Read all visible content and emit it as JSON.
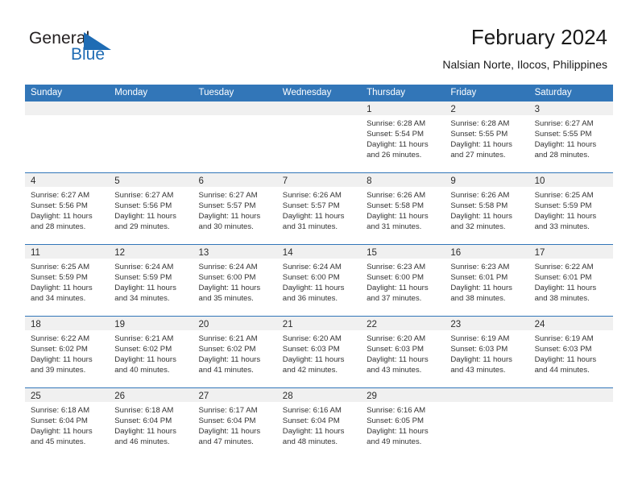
{
  "brand": {
    "word_one": "General",
    "word_two": "Blue",
    "triangle_icon": "triangle-icon",
    "colors": {
      "general": "#231f20",
      "blue": "#1f6cb4"
    }
  },
  "header": {
    "title": "February 2024",
    "subtitle": "Nalsian Norte, Ilocos, Philippines"
  },
  "colors": {
    "header_blue": "#3276b8",
    "day_band_gray": "#f0f0f0",
    "text": "#333333"
  },
  "calendar": {
    "weekday_headers": [
      "Sunday",
      "Monday",
      "Tuesday",
      "Wednesday",
      "Thursday",
      "Friday",
      "Saturday"
    ],
    "weeks": [
      [
        {
          "day": "",
          "lines": []
        },
        {
          "day": "",
          "lines": []
        },
        {
          "day": "",
          "lines": []
        },
        {
          "day": "",
          "lines": []
        },
        {
          "day": "1",
          "lines": [
            "Sunrise: 6:28 AM",
            "Sunset: 5:54 PM",
            "Daylight: 11 hours",
            "and 26 minutes."
          ]
        },
        {
          "day": "2",
          "lines": [
            "Sunrise: 6:28 AM",
            "Sunset: 5:55 PM",
            "Daylight: 11 hours",
            "and 27 minutes."
          ]
        },
        {
          "day": "3",
          "lines": [
            "Sunrise: 6:27 AM",
            "Sunset: 5:55 PM",
            "Daylight: 11 hours",
            "and 28 minutes."
          ]
        }
      ],
      [
        {
          "day": "4",
          "lines": [
            "Sunrise: 6:27 AM",
            "Sunset: 5:56 PM",
            "Daylight: 11 hours",
            "and 28 minutes."
          ]
        },
        {
          "day": "5",
          "lines": [
            "Sunrise: 6:27 AM",
            "Sunset: 5:56 PM",
            "Daylight: 11 hours",
            "and 29 minutes."
          ]
        },
        {
          "day": "6",
          "lines": [
            "Sunrise: 6:27 AM",
            "Sunset: 5:57 PM",
            "Daylight: 11 hours",
            "and 30 minutes."
          ]
        },
        {
          "day": "7",
          "lines": [
            "Sunrise: 6:26 AM",
            "Sunset: 5:57 PM",
            "Daylight: 11 hours",
            "and 31 minutes."
          ]
        },
        {
          "day": "8",
          "lines": [
            "Sunrise: 6:26 AM",
            "Sunset: 5:58 PM",
            "Daylight: 11 hours",
            "and 31 minutes."
          ]
        },
        {
          "day": "9",
          "lines": [
            "Sunrise: 6:26 AM",
            "Sunset: 5:58 PM",
            "Daylight: 11 hours",
            "and 32 minutes."
          ]
        },
        {
          "day": "10",
          "lines": [
            "Sunrise: 6:25 AM",
            "Sunset: 5:59 PM",
            "Daylight: 11 hours",
            "and 33 minutes."
          ]
        }
      ],
      [
        {
          "day": "11",
          "lines": [
            "Sunrise: 6:25 AM",
            "Sunset: 5:59 PM",
            "Daylight: 11 hours",
            "and 34 minutes."
          ]
        },
        {
          "day": "12",
          "lines": [
            "Sunrise: 6:24 AM",
            "Sunset: 5:59 PM",
            "Daylight: 11 hours",
            "and 34 minutes."
          ]
        },
        {
          "day": "13",
          "lines": [
            "Sunrise: 6:24 AM",
            "Sunset: 6:00 PM",
            "Daylight: 11 hours",
            "and 35 minutes."
          ]
        },
        {
          "day": "14",
          "lines": [
            "Sunrise: 6:24 AM",
            "Sunset: 6:00 PM",
            "Daylight: 11 hours",
            "and 36 minutes."
          ]
        },
        {
          "day": "15",
          "lines": [
            "Sunrise: 6:23 AM",
            "Sunset: 6:00 PM",
            "Daylight: 11 hours",
            "and 37 minutes."
          ]
        },
        {
          "day": "16",
          "lines": [
            "Sunrise: 6:23 AM",
            "Sunset: 6:01 PM",
            "Daylight: 11 hours",
            "and 38 minutes."
          ]
        },
        {
          "day": "17",
          "lines": [
            "Sunrise: 6:22 AM",
            "Sunset: 6:01 PM",
            "Daylight: 11 hours",
            "and 38 minutes."
          ]
        }
      ],
      [
        {
          "day": "18",
          "lines": [
            "Sunrise: 6:22 AM",
            "Sunset: 6:02 PM",
            "Daylight: 11 hours",
            "and 39 minutes."
          ]
        },
        {
          "day": "19",
          "lines": [
            "Sunrise: 6:21 AM",
            "Sunset: 6:02 PM",
            "Daylight: 11 hours",
            "and 40 minutes."
          ]
        },
        {
          "day": "20",
          "lines": [
            "Sunrise: 6:21 AM",
            "Sunset: 6:02 PM",
            "Daylight: 11 hours",
            "and 41 minutes."
          ]
        },
        {
          "day": "21",
          "lines": [
            "Sunrise: 6:20 AM",
            "Sunset: 6:03 PM",
            "Daylight: 11 hours",
            "and 42 minutes."
          ]
        },
        {
          "day": "22",
          "lines": [
            "Sunrise: 6:20 AM",
            "Sunset: 6:03 PM",
            "Daylight: 11 hours",
            "and 43 minutes."
          ]
        },
        {
          "day": "23",
          "lines": [
            "Sunrise: 6:19 AM",
            "Sunset: 6:03 PM",
            "Daylight: 11 hours",
            "and 43 minutes."
          ]
        },
        {
          "day": "24",
          "lines": [
            "Sunrise: 6:19 AM",
            "Sunset: 6:03 PM",
            "Daylight: 11 hours",
            "and 44 minutes."
          ]
        }
      ],
      [
        {
          "day": "25",
          "lines": [
            "Sunrise: 6:18 AM",
            "Sunset: 6:04 PM",
            "Daylight: 11 hours",
            "and 45 minutes."
          ]
        },
        {
          "day": "26",
          "lines": [
            "Sunrise: 6:18 AM",
            "Sunset: 6:04 PM",
            "Daylight: 11 hours",
            "and 46 minutes."
          ]
        },
        {
          "day": "27",
          "lines": [
            "Sunrise: 6:17 AM",
            "Sunset: 6:04 PM",
            "Daylight: 11 hours",
            "and 47 minutes."
          ]
        },
        {
          "day": "28",
          "lines": [
            "Sunrise: 6:16 AM",
            "Sunset: 6:04 PM",
            "Daylight: 11 hours",
            "and 48 minutes."
          ]
        },
        {
          "day": "29",
          "lines": [
            "Sunrise: 6:16 AM",
            "Sunset: 6:05 PM",
            "Daylight: 11 hours",
            "and 49 minutes."
          ]
        },
        {
          "day": "",
          "lines": []
        },
        {
          "day": "",
          "lines": []
        }
      ]
    ]
  }
}
